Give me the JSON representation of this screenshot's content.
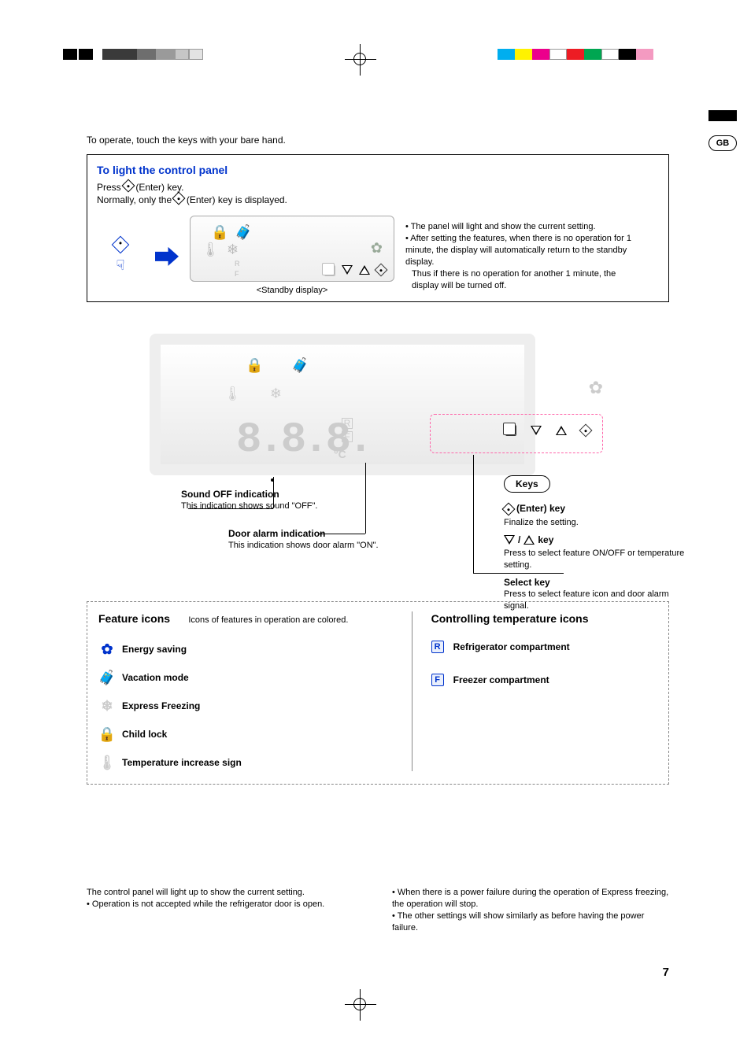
{
  "lang_tab": "GB",
  "intro": "To operate, touch the keys with your bare hand.",
  "panel": {
    "title": "To light the control panel",
    "press_prefix": "Press ",
    "press_suffix": " (Enter) key.",
    "normally_prefix": "Normally, only the ",
    "normally_suffix": " (Enter) key is displayed.",
    "standby_label": "<Standby display>",
    "note1": "• The panel will light and show the current setting.",
    "note2": "• After setting the features, when there is no operation for 1 minute, the display will automatically return to the standby display.",
    "note3": "Thus if there is no operation for another 1 minute, the display will be turned off."
  },
  "bigdisplay": {
    "segments": "8.8.8.",
    "unit": "°C",
    "r": "R",
    "f": "F"
  },
  "callouts": {
    "sound_title": "Sound OFF indication",
    "sound_body": "This indication shows sound \"OFF\".",
    "door_title": "Door alarm indication",
    "door_body": "This indication shows door alarm \"ON\".",
    "keys_pill": "Keys",
    "enter_label": " (Enter) key",
    "enter_body": "Finalize the setting.",
    "arrows_label": " key",
    "arrows_body": "Press to select feature ON/OFF or temperature setting.",
    "select_label": "Select key",
    "select_body": "Press to select feature icon and door alarm signal."
  },
  "features": {
    "heading": "Feature icons",
    "subnote": "Icons of features in operation are colored.",
    "energy": "Energy saving",
    "vacation": "Vacation mode",
    "express": "Express Freezing",
    "childlock": "Child lock",
    "tempinc": "Temperature increase sign",
    "temp_heading": "Controlling temperature icons",
    "r_label": "Refrigerator compartment",
    "r": "R",
    "f_label": "Freezer compartment",
    "f": "F"
  },
  "bottom": {
    "left1": "The control panel will light up to show the current setting.",
    "left2": "• Operation is not accepted while the refrigerator door is open.",
    "right1": "• When there is a power failure during the operation of Express freezing, the operation will stop.",
    "right2": "• The other settings will show similarly as before having the power failure."
  },
  "page_num": "7",
  "swatches": [
    "#000000",
    "#3a3a3a",
    "#6e6e6e",
    "#9a9a9a",
    "#c6c6c6",
    "#e3e3e3",
    "#ffffff",
    "#00aeef",
    "#fff200",
    "#ec008c",
    "#ed1c24",
    "#00a651",
    "#f7941d",
    "#f49ac1"
  ]
}
